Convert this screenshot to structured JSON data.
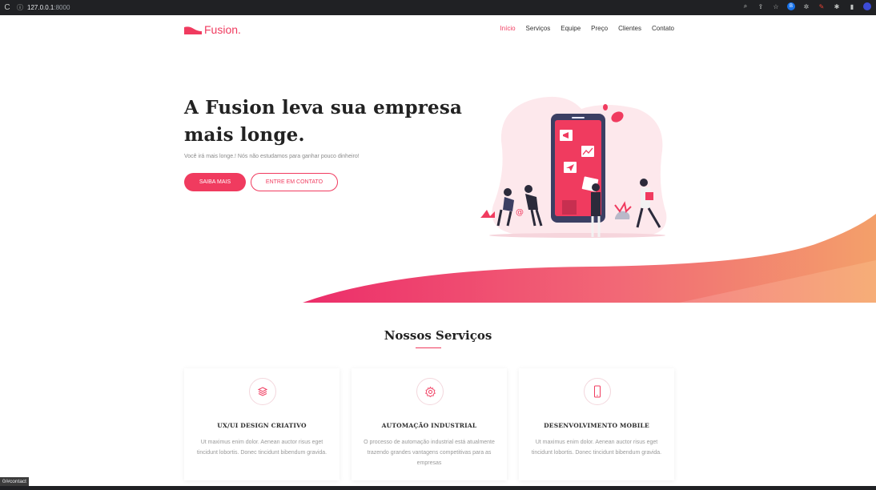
{
  "browser": {
    "url_host": "127.0.0.1",
    "url_port": ":8000"
  },
  "brand": {
    "name": "Fusion.",
    "color": "#f03b5f"
  },
  "nav": {
    "items": [
      "Início",
      "Serviços",
      "Equipe",
      "Preço",
      "Clientes",
      "Contato"
    ],
    "active": "Início"
  },
  "hero": {
    "title": "A Fusion leva sua empresa mais longe.",
    "subtitle": "Você irá mais longe.! Nós não estudamos para ganhar pouco dinheiro!",
    "primary_button": "SAIBA MAIS",
    "secondary_button": "ENTRE EM CONTATO"
  },
  "services": {
    "title": "Nossos Serviços",
    "cards": [
      {
        "icon": "layers-icon",
        "title": "UX/UI DESIGN CRIATIVO",
        "text": "Ut maximus enim dolor. Aenean auctor risus eget tincidunt lobortis. Donec tincidunt bibendum gravida."
      },
      {
        "icon": "gear-icon",
        "title": "AUTOMAÇÃO INDUSTRIAL",
        "text": "O processo de automação industrial está atualmente trazendo grandes vantagens competitivas para as empresas"
      },
      {
        "icon": "mobile-icon",
        "title": "DESENVOLVIMENTO MOBILE",
        "text": "Ut maximus enim dolor. Aenean auctor risus eget tincidunt lobortis. Donec tincidunt bibendum gravida."
      }
    ]
  },
  "status_bar": "0/#contact"
}
